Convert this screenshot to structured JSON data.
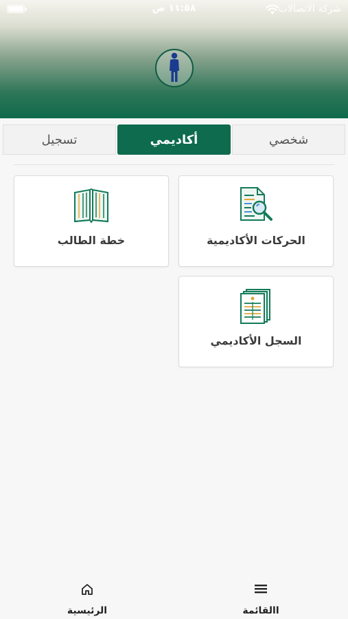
{
  "status_bar": {
    "carrier": "شركة الاتصالات",
    "time": "١١:٥٨ ص"
  },
  "header": {
    "avatar_icon": "person-icon"
  },
  "tabs": [
    {
      "label": "شخصي",
      "active": false
    },
    {
      "label": "أكاديمي",
      "active": true
    },
    {
      "label": "تسجيل",
      "active": false
    }
  ],
  "cards": {
    "academic_movements": {
      "label": "الحركات الأكاديمية",
      "icon": "document-search-icon"
    },
    "student_plan": {
      "label": "خطة الطالب",
      "icon": "open-book-icon"
    },
    "academic_record": {
      "label": "السجل الأكاديمي",
      "icon": "records-stack-icon"
    }
  },
  "bottom_nav": {
    "menu": {
      "label": "االقائمة",
      "icon": "hamburger-icon"
    },
    "home": {
      "label": "الرئيسية",
      "icon": "home-icon"
    }
  },
  "colors": {
    "accent": "#0e6b4d",
    "icon_stroke": "#127a58"
  }
}
